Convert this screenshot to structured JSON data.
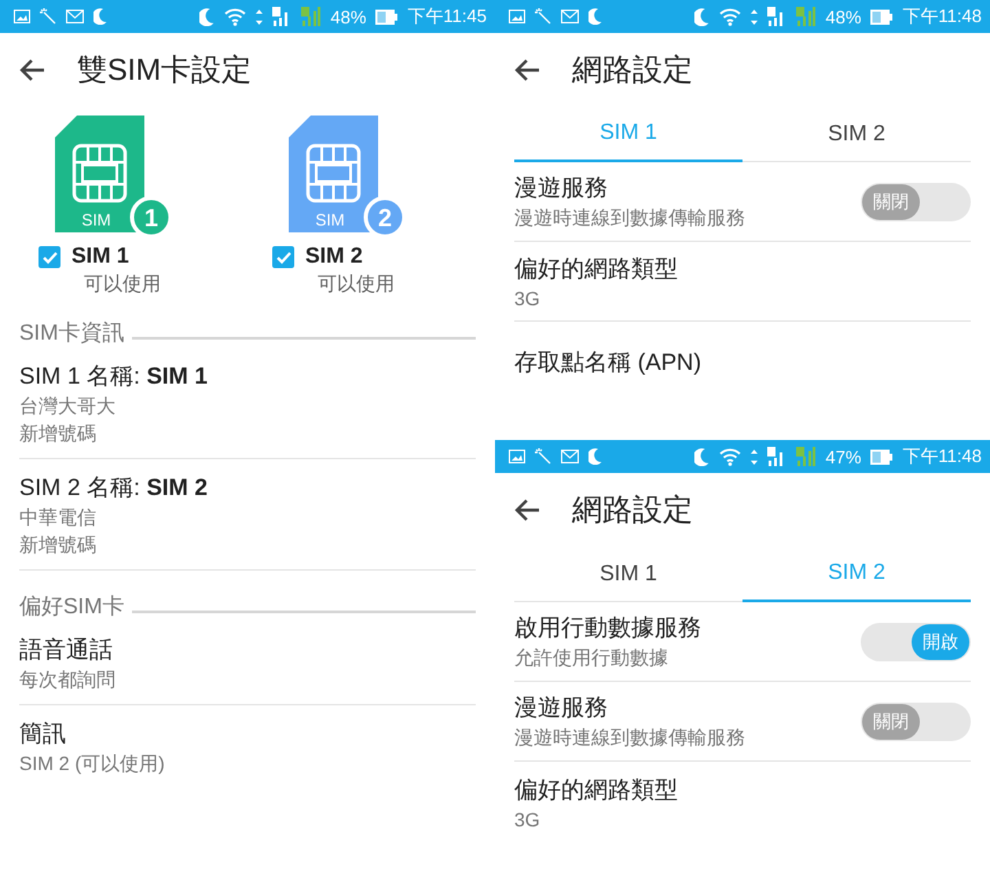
{
  "dual_sim_screen": {
    "status_bar": {
      "battery": "48%",
      "time": "下午11:45"
    },
    "title": "雙SIM卡設定",
    "sims": [
      {
        "label": "SIM 1",
        "status": "可以使用",
        "checked": true,
        "color": "#1db88a",
        "card_text": "SIM",
        "badge": "1"
      },
      {
        "label": "SIM 2",
        "status": "可以使用",
        "checked": true,
        "color": "#64a8f5",
        "card_text": "SIM",
        "badge": "2"
      }
    ],
    "sections": [
      {
        "header": "SIM卡資訊",
        "items": [
          {
            "title": "SIM 1 名稱: **SIM 1**",
            "subtitles": [
              "台灣大哥大",
              "新增號碼"
            ]
          },
          {
            "title": "SIM 2 名稱: **SIM 2**",
            "subtitles": [
              "中華電信",
              "新增號碼"
            ]
          }
        ]
      },
      {
        "header": "偏好SIM卡",
        "items": [
          {
            "title": "語音通話",
            "subtitles": [
              "每次都詢問"
            ]
          },
          {
            "title": "簡訊",
            "subtitles": [
              "SIM 2 (可以使用)"
            ]
          }
        ]
      }
    ]
  },
  "network_screens": [
    {
      "status_bar": {
        "battery": "48%",
        "time": "下午11:48"
      },
      "title": "網路設定",
      "tabs": [
        {
          "label": "SIM 1",
          "selected": true
        },
        {
          "label": "SIM 2",
          "selected": false
        }
      ],
      "items": [
        {
          "kind": "switch",
          "title": "漫遊服務",
          "subtitle": "漫遊時連線到數據傳輸服務",
          "on": false,
          "switch_label": "關閉"
        },
        {
          "kind": "text",
          "title": "偏好的網路類型",
          "subtitle": "3G"
        },
        {
          "kind": "text",
          "title": "存取點名稱 (APN)"
        }
      ]
    },
    {
      "status_bar": {
        "battery": "47%",
        "time": "下午11:48"
      },
      "title": "網路設定",
      "tabs": [
        {
          "label": "SIM 1",
          "selected": false
        },
        {
          "label": "SIM 2",
          "selected": true
        }
      ],
      "items": [
        {
          "kind": "switch",
          "title": "啟用行動數據服務",
          "subtitle": "允許使用行動數據",
          "on": true,
          "switch_label": "開啟"
        },
        {
          "kind": "switch",
          "title": "漫遊服務",
          "subtitle": "漫遊時連線到數據傳輸服務",
          "on": false,
          "switch_label": "關閉"
        },
        {
          "kind": "text",
          "title": "偏好的網路類型",
          "subtitle": "3G"
        }
      ]
    }
  ]
}
